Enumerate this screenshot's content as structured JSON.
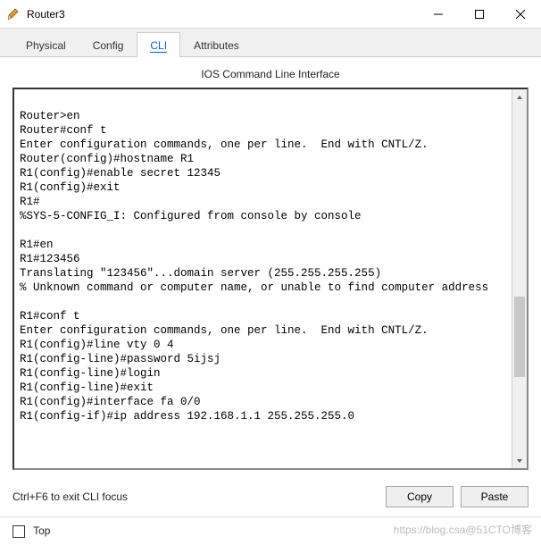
{
  "window": {
    "title": "Router3"
  },
  "tabs": [
    {
      "label": "Physical"
    },
    {
      "label": "Config"
    },
    {
      "label": "CLI"
    },
    {
      "label": "Attributes"
    }
  ],
  "active_tab_index": 2,
  "panel": {
    "title": "IOS Command Line Interface"
  },
  "terminal": {
    "text": "\nRouter>en\nRouter#conf t\nEnter configuration commands, one per line.  End with CNTL/Z.\nRouter(config)#hostname R1\nR1(config)#enable secret 12345\nR1(config)#exit\nR1#\n%SYS-5-CONFIG_I: Configured from console by console\n\nR1#en\nR1#123456\nTranslating \"123456\"...domain server (255.255.255.255)\n% Unknown command or computer name, or unable to find computer address\n\nR1#conf t\nEnter configuration commands, one per line.  End with CNTL/Z.\nR1(config)#line vty 0 4\nR1(config-line)#password 5ijsj\nR1(config-line)#login\nR1(config-line)#exit\nR1(config)#interface fa 0/0\nR1(config-if)#ip address 192.168.1.1 255.255.255.0"
  },
  "footer": {
    "hint": "Ctrl+F6 to exit CLI focus",
    "copy_label": "Copy",
    "paste_label": "Paste"
  },
  "bottom": {
    "top_label": "Top"
  },
  "watermark": "https://blog.csa@51CTO博客"
}
